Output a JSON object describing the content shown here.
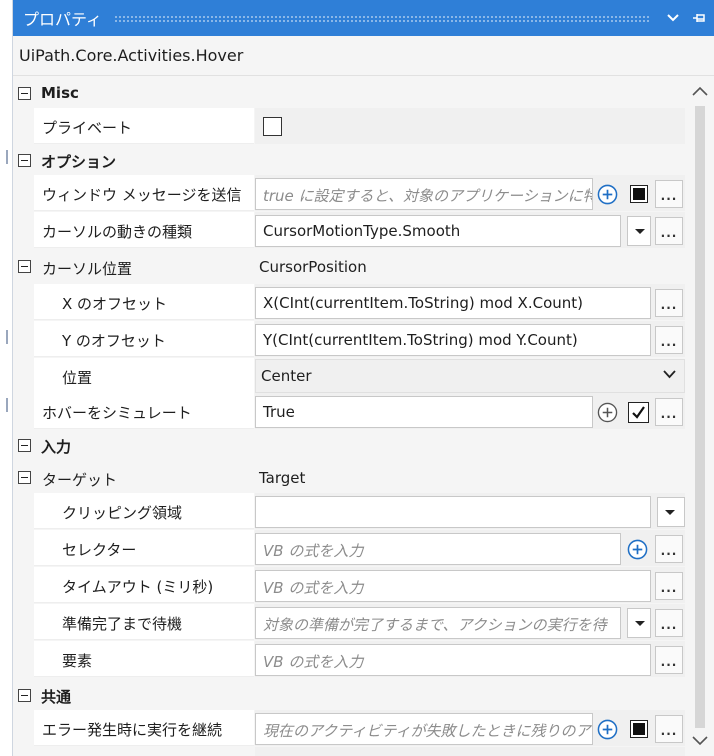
{
  "panel": {
    "title": "プロパティ",
    "activity_type": "UiPath.Core.Activities.Hover"
  },
  "categories": {
    "misc": "Misc",
    "options": "オプション",
    "input": "入力",
    "common": "共通"
  },
  "props": {
    "private": {
      "label": "プライベート",
      "checked": false
    },
    "send_window_messages": {
      "label": "ウィンドウ メッセージを送信",
      "placeholder": "true に設定すると、対象のアプリケーションに特"
    },
    "cursor_motion_type": {
      "label": "カーソルの動きの種類",
      "value": "CursorMotionType.Smooth"
    },
    "cursor_position": {
      "label": "カーソル位置",
      "value": "CursorPosition"
    },
    "offset_x": {
      "label": "X のオフセット",
      "value": "X(CInt(currentItem.ToString) mod X.Count)"
    },
    "offset_y": {
      "label": "Y のオフセット",
      "value": "Y(CInt(currentItem.ToString) mod Y.Count)"
    },
    "position": {
      "label": "位置",
      "value": "Center"
    },
    "simulate_hover": {
      "label": "ホバーをシミュレート",
      "value": "True"
    },
    "target": {
      "label": "ターゲット",
      "value": "Target"
    },
    "clipping_region": {
      "label": "クリッピング領域",
      "value": ""
    },
    "selector": {
      "label": "セレクター",
      "placeholder": "VB の式を入力"
    },
    "timeout": {
      "label": "タイムアウト (ミリ秒)",
      "placeholder": "VB の式を入力"
    },
    "wait_for_ready": {
      "label": "準備完了まで待機",
      "placeholder": "対象の準備が完了するまで、アクションの実行を待"
    },
    "element": {
      "label": "要素",
      "placeholder": "VB の式を入力"
    },
    "continue_on_error": {
      "label": "エラー発生時に実行を継続",
      "placeholder": "現在のアクティビティが失敗したときに残りのアク"
    }
  },
  "buttons": {
    "ellipsis": "..."
  },
  "colors": {
    "titlebar": "#2f7fd7",
    "plus_icon": "#1f6fc5"
  },
  "icons": [
    "chevron-down-icon",
    "pin-icon",
    "collapse-icon",
    "plus-circle-icon",
    "dropdown-arrow-icon",
    "checkmark-icon",
    "scroll-up-icon",
    "scroll-down-icon"
  ]
}
